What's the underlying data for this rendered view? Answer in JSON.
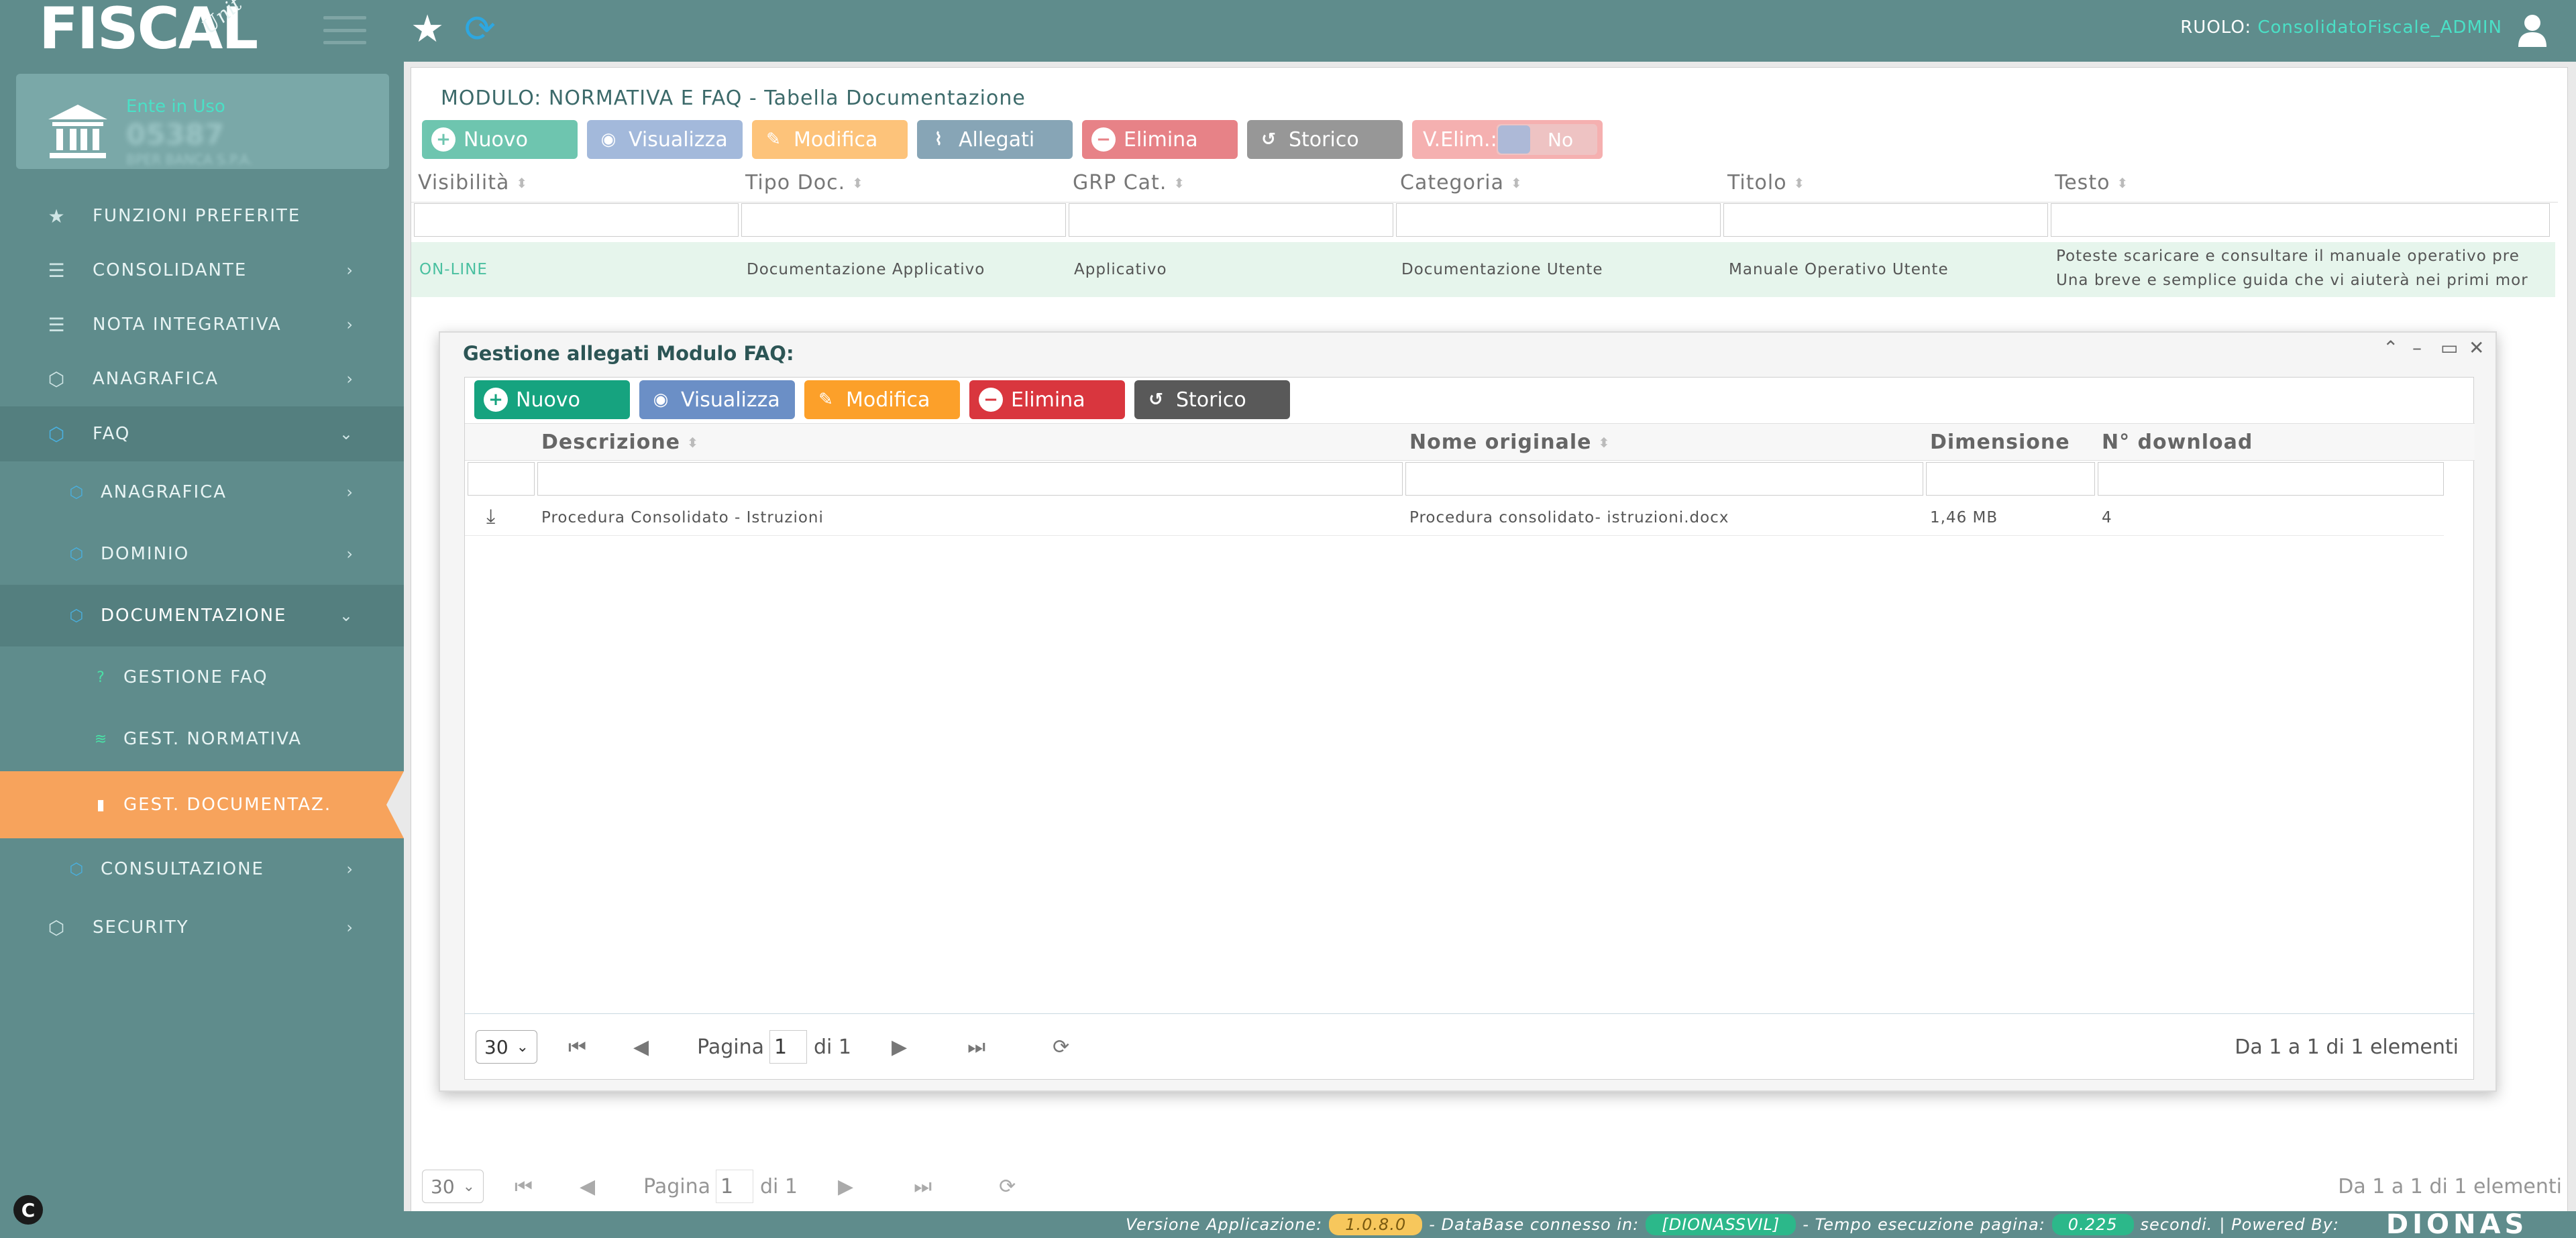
{
  "app": {
    "logo_text": "FISCAL",
    "logo_sub": "Unit",
    "role_label": "RUOLO:",
    "role_value": "ConsolidatoFiscale_ADMIN"
  },
  "ente": {
    "label": "Ente in Uso",
    "code": "05387",
    "name": "BPER BANCA S.P.A."
  },
  "sidebar": {
    "items": [
      {
        "label": "FUNZIONI PREFERITE"
      },
      {
        "label": "CONSOLIDANTE"
      },
      {
        "label": "NOTA INTEGRATIVA"
      },
      {
        "label": "ANAGRAFICA"
      },
      {
        "label": "FAQ"
      },
      {
        "label": "ANAGRAFICA"
      },
      {
        "label": "DOMINIO"
      },
      {
        "label": "DOCUMENTAZIONE"
      },
      {
        "label": "GESTIONE FAQ"
      },
      {
        "label": "GEST. NORMATIVA"
      },
      {
        "label": "GEST. DOCUMENTAZ."
      },
      {
        "label": "CONSULTAZIONE"
      },
      {
        "label": "SECURITY"
      }
    ]
  },
  "main": {
    "title": "MODULO: NORMATIVA E FAQ - Tabella Documentazione",
    "toolbar": {
      "nuovo": "Nuovo",
      "visualizza": "Visualizza",
      "modifica": "Modifica",
      "allegati": "Allegati",
      "elimina": "Elimina",
      "storico": "Storico",
      "velim": "V.Elim.:",
      "velim_toggle": "No"
    },
    "columns": [
      "Visibilità",
      "Tipo Doc.",
      "GRP Cat.",
      "Categoria",
      "Titolo",
      "Testo"
    ],
    "rows": [
      {
        "visibilita": "ON-LINE",
        "tipo_doc": "Documentazione Applicativo",
        "grp_cat": "Applicativo",
        "categoria": "Documentazione Utente",
        "titolo": "Manuale Operativo Utente",
        "testo_1": "Poteste scaricare e consultare il manuale operativo pre",
        "testo_2": "Una breve e semplice guida che vi aiuterà nei primi mor"
      }
    ],
    "pager": {
      "page_size": "30",
      "page_label": "Pagina",
      "page_value": "1",
      "of_label": "di 1",
      "summary": "Da 1 a 1 di 1 elementi"
    }
  },
  "dialog": {
    "title": "Gestione allegati Modulo FAQ:",
    "toolbar": {
      "nuovo": "Nuovo",
      "visualizza": "Visualizza",
      "modifica": "Modifica",
      "elimina": "Elimina",
      "storico": "Storico"
    },
    "columns": [
      "Descrizione",
      "Nome originale",
      "Dimensione",
      "N° download"
    ],
    "rows": [
      {
        "descrizione": "Procedura Consolidato - Istruzioni",
        "nome_originale": "Procedura consolidato- istruzioni.docx",
        "dimensione": "1,46 MB",
        "download": "4"
      }
    ],
    "pager": {
      "page_size": "30",
      "page_label": "Pagina",
      "page_value": "1",
      "of_label": "di 1",
      "summary": "Da 1 a 1 di 1 elementi"
    }
  },
  "footer": {
    "version_label": "Versione Applicazione:",
    "version_value": "1.0.8.0",
    "db_label": "- DataBase connesso in:",
    "db_value": "[DIONASSVIL]",
    "time_label": "- Tempo esecuzione pagina:",
    "time_value": "0.225",
    "time_unit": "secondi.",
    "powered_label": "| Powered By:",
    "brand": "DIONAS"
  },
  "colors": {
    "sidebar_bg": "#5f8c8c",
    "accent_teal": "#4ae0c6",
    "active_orange": "#f7a35c",
    "btn_nuovo": "#16a37f",
    "btn_visualizza": "#6b8fc6",
    "btn_modifica": "#fca02a",
    "btn_allegati": "#5f8c9a",
    "btn_elimina": "#d9363e",
    "btn_storico": "#595959"
  }
}
